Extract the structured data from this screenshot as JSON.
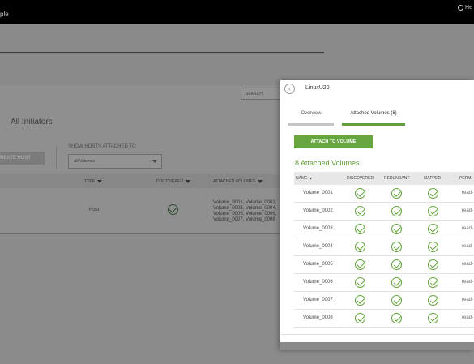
{
  "topbar": {
    "brand": "ple",
    "help": "He"
  },
  "background": {
    "search_placeholder": "SEARCH",
    "title": "All Initiators",
    "create_host_label": "REATE HOST",
    "show_hosts_label": "SHOW HOSTS ATTACHED TO",
    "volume_filter_value": "All Volumes",
    "columns": {
      "type": "TYPE",
      "discovered": "DISCOVERED",
      "attached_volumes": "ATTACHED VOLUMES"
    },
    "row": {
      "type": "Host",
      "volumes_lines": [
        "Volume_0001, Volume_0002,",
        "Volume_0003, Volume_0004,",
        "Volume_0005, Volume_0006,",
        "Volume_0007, Volume_0008"
      ]
    }
  },
  "panel": {
    "title": "LinuxU20",
    "tabs": [
      {
        "label": "Overview",
        "active": false
      },
      {
        "label": "Attached Volumes (8)",
        "active": true
      }
    ],
    "attach_button": "ATTACH TO VOLUME",
    "count_title": "8 Attached Volumes",
    "columns": {
      "name": "NAME",
      "discovered": "DISCOVERED",
      "redundant": "REDUNDANT",
      "mapped": "MAPPED",
      "permissions": "PERMI"
    },
    "rows": [
      {
        "name": "Volume_0001",
        "permission": "read-"
      },
      {
        "name": "Volume_0002",
        "permission": "read-"
      },
      {
        "name": "Volume_0003",
        "permission": "read-"
      },
      {
        "name": "Volume_0004",
        "permission": "read-"
      },
      {
        "name": "Volume_0005",
        "permission": "read-"
      },
      {
        "name": "Volume_0006",
        "permission": "read-"
      },
      {
        "name": "Volume_0007",
        "permission": "read-"
      },
      {
        "name": "Volume_0008",
        "permission": "read-"
      }
    ]
  },
  "colors": {
    "accent_green": "#67a53f",
    "overlay_gray": "#8b8b8b",
    "topbar": "#000000"
  }
}
